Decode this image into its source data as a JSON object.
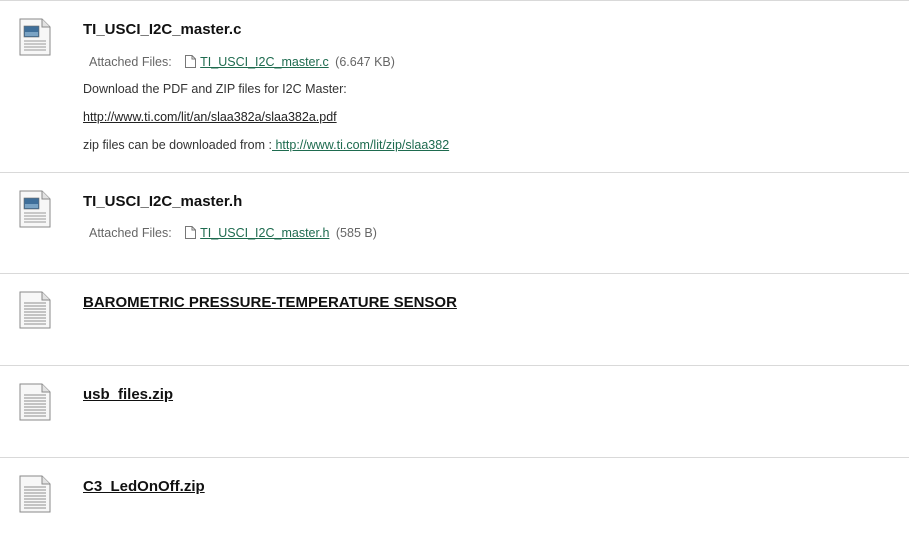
{
  "items": [
    {
      "title": "TI_USCI_I2C_master.c",
      "icon": "image-file-icon",
      "attachment": {
        "label": "Attached Files:",
        "file_name": "TI_USCI_I2C_master.c",
        "file_size": "(6.647 KB)"
      },
      "description": "Download the PDF and ZIP files for I2C Master:",
      "pdf_link": "http://www.ti.com/lit/an/slaa382a/slaa382a.pdf",
      "zip_prefix": "zip files can be downloaded from :",
      "zip_link": " http://www.ti.com/lit/zip/slaa382"
    },
    {
      "title": "TI_USCI_I2C_master.h",
      "icon": "image-file-icon",
      "attachment": {
        "label": "Attached Files:",
        "file_name": "TI_USCI_I2C_master.h",
        "file_size": "(585 B)"
      }
    },
    {
      "title": "BAROMETRIC PRESSURE-TEMPERATURE SENSOR",
      "icon": "document-icon"
    },
    {
      "title": "usb_files.zip",
      "icon": "document-icon"
    },
    {
      "title": "C3_LedOnOff.zip",
      "icon": "document-icon"
    }
  ]
}
